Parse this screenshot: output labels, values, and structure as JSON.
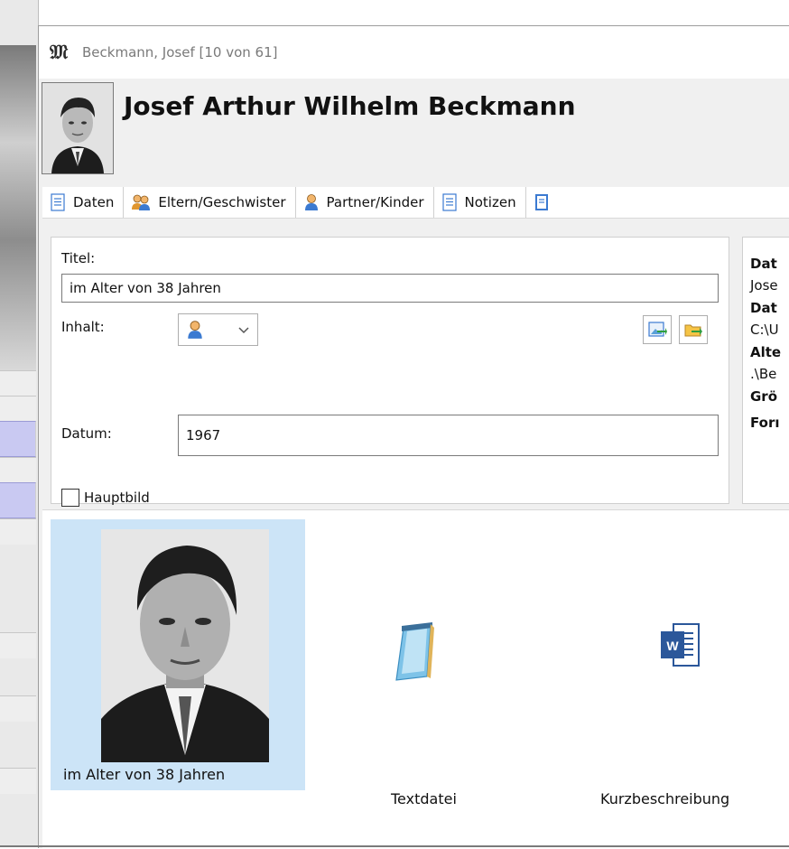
{
  "window": {
    "title": "Beckmann, Josef [10 von 61]",
    "app_icon": "gothic-letter-icon"
  },
  "person": {
    "full_name": "Josef Arthur Wilhelm Beckmann"
  },
  "tabs": [
    {
      "label": "Daten",
      "icon": "document-icon"
    },
    {
      "label": "Eltern/Geschwister",
      "icon": "family-icon"
    },
    {
      "label": "Partner/Kinder",
      "icon": "person-icon"
    },
    {
      "label": "Notizen",
      "icon": "document-icon"
    }
  ],
  "form": {
    "titel_label": "Titel:",
    "titel_value": "im Alter von 38 Jahren",
    "inhalt_label": "Inhalt:",
    "datum_label": "Datum:",
    "datum_value": "1967",
    "hauptbild_label": "Hauptbild",
    "hauptbild_checked": false
  },
  "info_panel": {
    "rows": [
      {
        "text": "Dat",
        "bold": true
      },
      {
        "text": "Jose",
        "bold": false
      },
      {
        "text": "Dat",
        "bold": true
      },
      {
        "text": "C:\\U",
        "bold": false
      },
      {
        "text": "Alte",
        "bold": true
      },
      {
        "text": ".\\Be",
        "bold": false
      },
      {
        "text": "Grö",
        "bold": true
      },
      {
        "text": "Forı",
        "bold": true
      }
    ]
  },
  "media": {
    "items": [
      {
        "caption": "im Alter von 38 Jahren",
        "icon": "photo-thumbnail",
        "selected": true
      },
      {
        "caption": "Textdatei",
        "icon": "notepad-icon",
        "selected": false
      },
      {
        "caption": "Kurzbeschreibung",
        "icon": "word-document-icon",
        "selected": false
      }
    ]
  },
  "colors": {
    "selection": "#cce4f7",
    "word_blue": "#2b579a",
    "tab_background": "#ffffff"
  }
}
